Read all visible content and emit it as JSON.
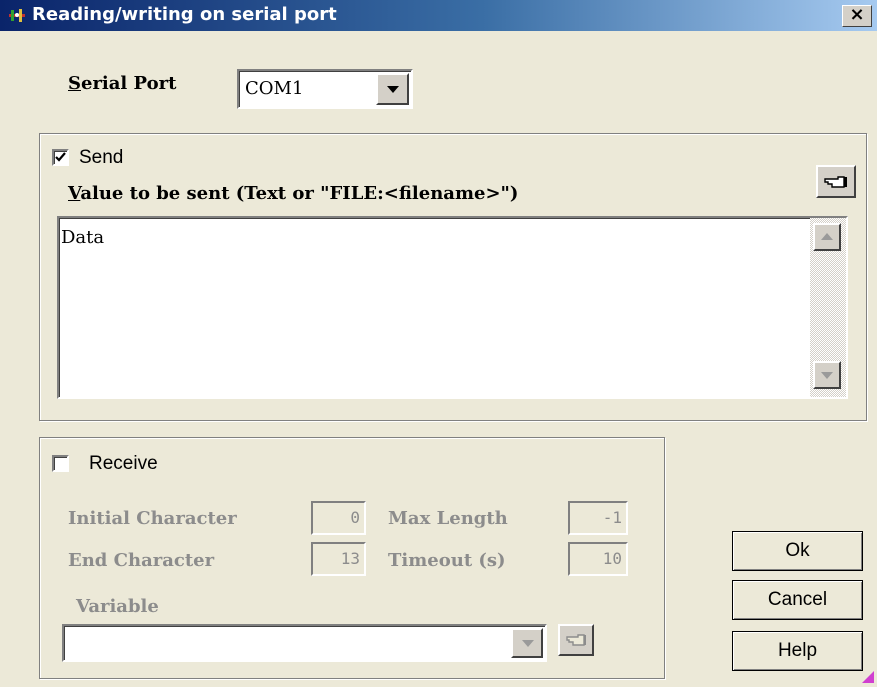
{
  "window": {
    "title": "Reading/writing on serial port",
    "close_label": "×"
  },
  "serial_port": {
    "label_prefix": "S",
    "label_rest": "erial Port",
    "value": "COM1"
  },
  "send": {
    "checkbox_label": "Send",
    "checked": true,
    "value_label_prefix": "V",
    "value_label_rest": "alue to be sent (Text or \"FILE:<filename>\")",
    "value": "Data"
  },
  "receive": {
    "checkbox_label": "Receive",
    "checked": false,
    "initial_character_label": "Initial Character",
    "initial_character_value": "0",
    "max_length_label": "Max Length",
    "max_length_value": "-1",
    "end_character_label": "End Character",
    "end_character_value": "13",
    "timeout_label": "Timeout (s)",
    "timeout_value": "10",
    "variable_label": "Variable",
    "variable_value": ""
  },
  "buttons": {
    "ok": "Ok",
    "cancel": "Cancel",
    "help": "Help"
  }
}
